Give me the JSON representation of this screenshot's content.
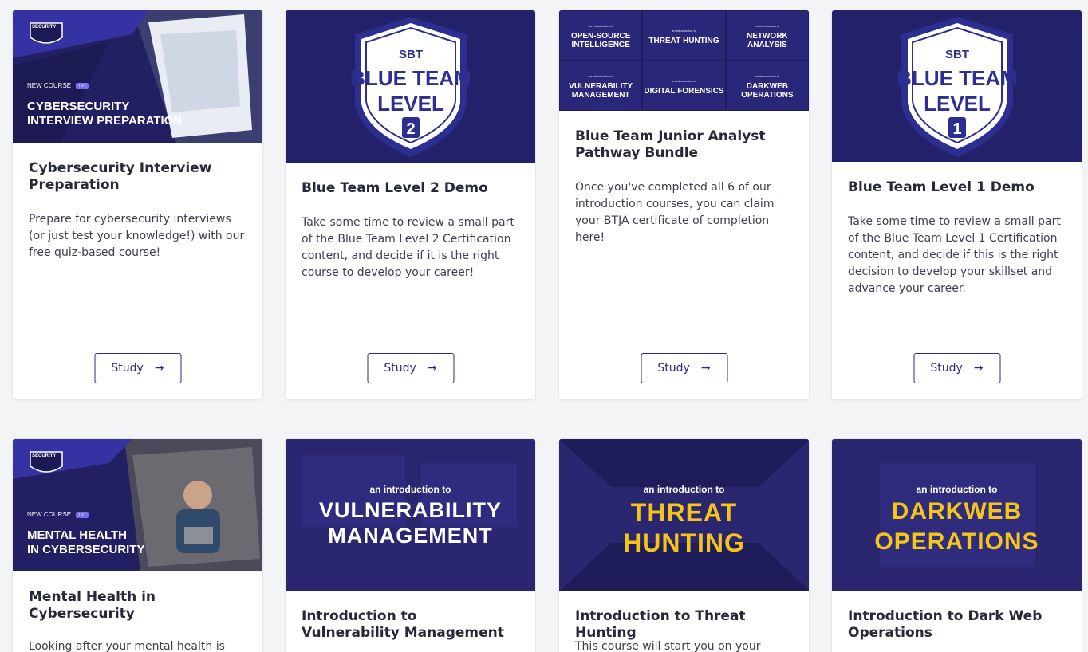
{
  "cards": [
    {
      "banner": {
        "new_course": "NEW COURSE",
        "pill": "TRY",
        "headline_1": "CYBERSECURITY",
        "headline_2": "INTERVIEW PREPARATION",
        "logo_text": "SECURITY"
      },
      "title": "Cybersecurity Interview Preparation",
      "description": "Prepare for cybersecurity interviews (or just test your knowledge!) with our free quiz-based course!",
      "button": "Study"
    },
    {
      "banner": {
        "top": "SBT",
        "line1": "BLUE TEAM",
        "line2": "LEVEL",
        "num": "2"
      },
      "title": "Blue Team Level 2 Demo",
      "description": "Take some time to review a small part of the Blue Team Level 2 Certification content, and decide if it is the right course to develop your career!",
      "button": "Study"
    },
    {
      "banner": {
        "tiny": "an introduction to",
        "cells": [
          "OPEN-SOURCE INTELLIGENCE",
          "THREAT HUNTING",
          "NETWORK ANALYSIS",
          "VULNERABILITY MANAGEMENT",
          "DIGITAL FORENSICS",
          "DARKWEB OPERATIONS"
        ]
      },
      "title": "Blue Team Junior Analyst Pathway Bundle",
      "description": "Once you've completed all 6 of our introduction courses, you can claim your BTJA certificate of completion here!",
      "button": "Study"
    },
    {
      "banner": {
        "top": "SBT",
        "line1": "BLUE TEAM",
        "line2": "LEVEL",
        "num": "1"
      },
      "title": "Blue Team Level 1 Demo",
      "description": "Take some time to review a small part of the Blue Team Level 1 Certification content, and decide if this is the right decision to develop your skillset and advance your career.",
      "button": "Study"
    },
    {
      "banner": {
        "new_course": "NEW COURSE",
        "pill": "TRY",
        "headline_1": "MENTAL HEALTH",
        "headline_2": "IN CYBERSECURITY",
        "logo_text": "SECURITY"
      },
      "title": "Mental Health in Cybersecurity",
      "description": "Looking after your mental health is"
    },
    {
      "banner": {
        "intro": "an introduction to",
        "line1": "VULNERABILITY",
        "line2": "MANAGEMENT"
      },
      "title": "Introduction to Vulnerability Management"
    },
    {
      "banner": {
        "intro": "an introduction to",
        "line1": "THREAT",
        "line2": "HUNTING"
      },
      "title": "Introduction to Threat Hunting",
      "description": "This course will start you on your"
    },
    {
      "banner": {
        "intro": "an introduction to",
        "line1": "DARKWEB",
        "line2": "OPERATIONS"
      },
      "title": "Introduction to Dark Web Operations"
    }
  ],
  "colors": {
    "brand": "#2d2a87",
    "banner_bg": "#24216b",
    "accent_yellow": "#f5c518"
  },
  "icons": {
    "button_arrow": "arrow-right-icon"
  }
}
